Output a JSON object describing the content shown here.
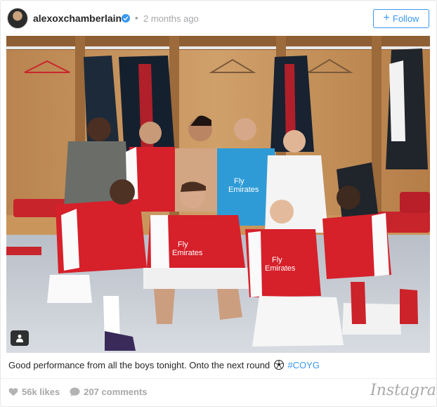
{
  "header": {
    "username": "alexoxchamberlain",
    "separator": "•",
    "timestamp": "2 months ago",
    "follow_label": "Follow",
    "follow_plus": "+"
  },
  "photo": {
    "jersey_sponsor": "Fly Emirates"
  },
  "caption": {
    "text": "Good performance from all the boys tonight. Onto the next round",
    "hashtag": "#COYG"
  },
  "stats": {
    "likes": "56k likes",
    "comments": "207 comments"
  },
  "brand": {
    "logo_text": "Instagram"
  },
  "colors": {
    "accent": "#3897f0",
    "arsenal_red": "#d6202a",
    "goalkeeper_blue": "#2f9bd6",
    "meta_grey": "#a5a7aa"
  },
  "icons": [
    "verified-badge-icon",
    "user-tag-icon",
    "heart-icon",
    "comment-icon",
    "soccer-ball-emoji"
  ]
}
